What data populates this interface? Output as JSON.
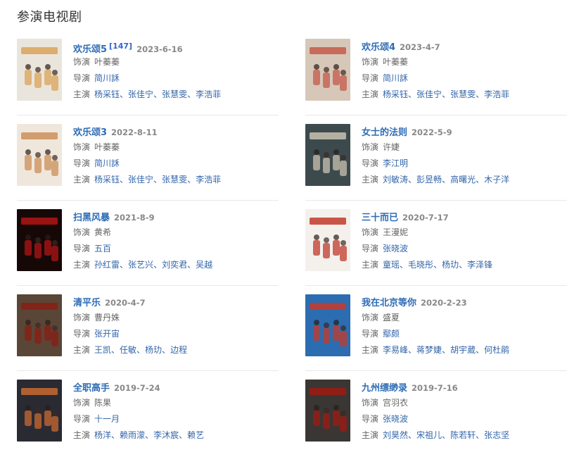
{
  "section": {
    "title": "参演电视剧"
  },
  "labels": {
    "role": "饰演",
    "director": "导演",
    "cast": "主演"
  },
  "shows": [
    {
      "title": "欢乐颂5",
      "badge": "[147]",
      "date": "2023-6-16",
      "role": "叶蓁蓁",
      "director": "简川訸",
      "cast": [
        "杨采钰",
        "张佳宁",
        "张慧雯",
        "李浩菲"
      ],
      "poster": {
        "bg": "#eae5dc",
        "accent": "#d9a35a"
      }
    },
    {
      "title": "欢乐颂4",
      "badge": "",
      "date": "2023-4-7",
      "role": "叶蓁蓁",
      "director": "简川訸",
      "cast": [
        "杨采钰",
        "张佳宁",
        "张慧雯",
        "李浩菲"
      ],
      "poster": {
        "bg": "#d7c7b8",
        "accent": "#c45a4a"
      }
    },
    {
      "title": "欢乐颂3",
      "badge": "",
      "date": "2022-8-11",
      "role": "叶蓁蓁",
      "director": "简川訸",
      "cast": [
        "杨采钰",
        "张佳宁",
        "张慧雯",
        "李浩菲"
      ],
      "poster": {
        "bg": "#efe7dc",
        "accent": "#cc8f5a"
      }
    },
    {
      "title": "女士的法则",
      "badge": "",
      "date": "2022-5-9",
      "role": "许婕",
      "director": "李江明",
      "cast": [
        "刘敏涛",
        "彭昱畅",
        "高曙光",
        "木子洋"
      ],
      "poster": {
        "bg": "#3c4a4e",
        "accent": "#c9c2b0"
      }
    },
    {
      "title": "扫黑风暴",
      "badge": "",
      "date": "2021-8-9",
      "role": "黄希",
      "director": "五百",
      "cast": [
        "孙红雷",
        "张艺兴",
        "刘奕君",
        "吴越"
      ],
      "poster": {
        "bg": "#170808",
        "accent": "#b21414"
      }
    },
    {
      "title": "三十而已",
      "badge": "",
      "date": "2020-7-17",
      "role": "王漫妮",
      "director": "张晓波",
      "cast": [
        "童瑶",
        "毛晓彤",
        "杨玏",
        "李泽锋"
      ],
      "poster": {
        "bg": "#f4f0ec",
        "accent": "#c0392b"
      }
    },
    {
      "title": "清平乐",
      "badge": "",
      "date": "2020-4-7",
      "role": "曹丹姝",
      "director": "张开宙",
      "cast": [
        "王凯",
        "任敏",
        "杨玏",
        "边程"
      ],
      "poster": {
        "bg": "#5a4636",
        "accent": "#8a1e14"
      }
    },
    {
      "title": "我在北京等你",
      "badge": "",
      "date": "2020-2-23",
      "role": "盛夏",
      "director": "鄢颇",
      "cast": [
        "李易峰",
        "蒋梦婕",
        "胡宇葳",
        "何杜鹃"
      ],
      "poster": {
        "bg": "#2b6db0",
        "accent": "#c83a2a"
      }
    },
    {
      "title": "全职高手",
      "badge": "",
      "date": "2019-7-24",
      "role": "陈果",
      "director": "十一月",
      "cast": [
        "杨洋",
        "赖雨濛",
        "李沐宸",
        "赖艺"
      ],
      "poster": {
        "bg": "#2a2a33",
        "accent": "#c86a30"
      }
    },
    {
      "title": "九州缥缈录",
      "badge": "",
      "date": "2019-7-16",
      "role": "宫羽衣",
      "director": "张晓波",
      "cast": [
        "刘昊然",
        "宋祖儿",
        "陈若轩",
        "张志坚"
      ],
      "poster": {
        "bg": "#3a3634",
        "accent": "#a01a12"
      }
    }
  ]
}
